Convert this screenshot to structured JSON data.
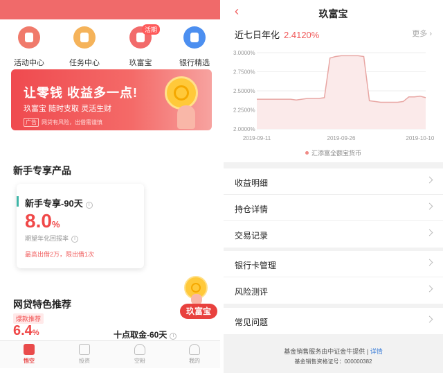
{
  "left": {
    "quick_items": [
      {
        "label": "活动中心",
        "icon": "activity-icon",
        "color": "#f07a6b"
      },
      {
        "label": "任务中心",
        "icon": "task-icon",
        "color": "#f5b35a"
      },
      {
        "label": "玖富宝",
        "icon": "wallet-icon",
        "color": "#f26b6b",
        "badge": "活期"
      },
      {
        "label": "银行精选",
        "icon": "bank-icon",
        "color": "#4c8ff0"
      }
    ],
    "banner": {
      "title": "让零钱 收益多一点!",
      "subtitle": "玖富宝 随时支取 灵活生财",
      "ad_tag": "广告",
      "risk_note": "网贷有风险，出借需谨慎"
    },
    "newbie": {
      "section_title": "新手专享产品",
      "product_name": "新手专享-90天",
      "rate_value": "8.0",
      "rate_unit": "%",
      "rate_label": "期望年化回报率",
      "limit_text": "最高出借2万，限出借1次"
    },
    "featured": {
      "section_title": "网贷特色推荐",
      "badge": "爆款推荐",
      "rate_value": "6.4",
      "rate_unit": "%",
      "product_name": "十点取金-60天"
    },
    "floating_label": "玖富宝",
    "tabs": [
      {
        "label": "悟空",
        "icon": "wukong-icon",
        "active": true
      },
      {
        "label": "投资",
        "icon": "invest-icon",
        "active": false
      },
      {
        "label": "空粉",
        "icon": "fans-icon",
        "active": false
      },
      {
        "label": "我的",
        "icon": "profile-icon",
        "active": false
      }
    ],
    "accent": "#f04848"
  },
  "right": {
    "nav_title": "玖富宝",
    "yield_label": "近七日年化",
    "yield_value": "2.4120%",
    "more_label": "更多",
    "menu_groups": [
      [
        "收益明细",
        "持仓详情",
        "交易记录"
      ],
      [
        "银行卡管理",
        "风险测评"
      ],
      [
        "常见问题"
      ]
    ],
    "footer_line1": "基金销售服务由中证金牛提供",
    "footer_sep": "|",
    "footer_link": "详情",
    "footer_line2": "基金销售资格证号：000000382"
  },
  "chart_data": {
    "type": "area",
    "y_tick_labels": [
      "2.0000%",
      "2.2500%",
      "2.5000%",
      "2.7500%",
      "3.0000%"
    ],
    "x_tick_labels": [
      "2019-09-11",
      "2019-09-26",
      "2019-10-10"
    ],
    "ylim": [
      2.0,
      3.0
    ],
    "x": [
      "2019-09-11",
      "2019-09-12",
      "2019-09-13",
      "2019-09-14",
      "2019-09-15",
      "2019-09-16",
      "2019-09-17",
      "2019-09-18",
      "2019-09-19",
      "2019-09-20",
      "2019-09-21",
      "2019-09-22",
      "2019-09-23",
      "2019-09-24",
      "2019-09-25",
      "2019-09-26",
      "2019-09-27",
      "2019-09-28",
      "2019-09-29",
      "2019-09-30",
      "2019-10-01",
      "2019-10-02",
      "2019-10-03",
      "2019-10-04",
      "2019-10-05",
      "2019-10-06",
      "2019-10-07",
      "2019-10-08",
      "2019-10-09",
      "2019-10-10",
      "2019-10-11"
    ],
    "series": [
      {
        "name": "汇添富全额宝货币",
        "values": [
          2.39,
          2.39,
          2.39,
          2.39,
          2.39,
          2.39,
          2.39,
          2.38,
          2.39,
          2.4,
          2.4,
          2.4,
          2.41,
          2.93,
          2.95,
          2.96,
          2.96,
          2.96,
          2.96,
          2.95,
          2.37,
          2.36,
          2.35,
          2.35,
          2.35,
          2.35,
          2.36,
          2.42,
          2.42,
          2.43,
          2.41
        ]
      }
    ],
    "line_color": "#e8a6a3",
    "fill_color": "#fbeaea",
    "grid": true,
    "legend_position": "bottom-center"
  }
}
